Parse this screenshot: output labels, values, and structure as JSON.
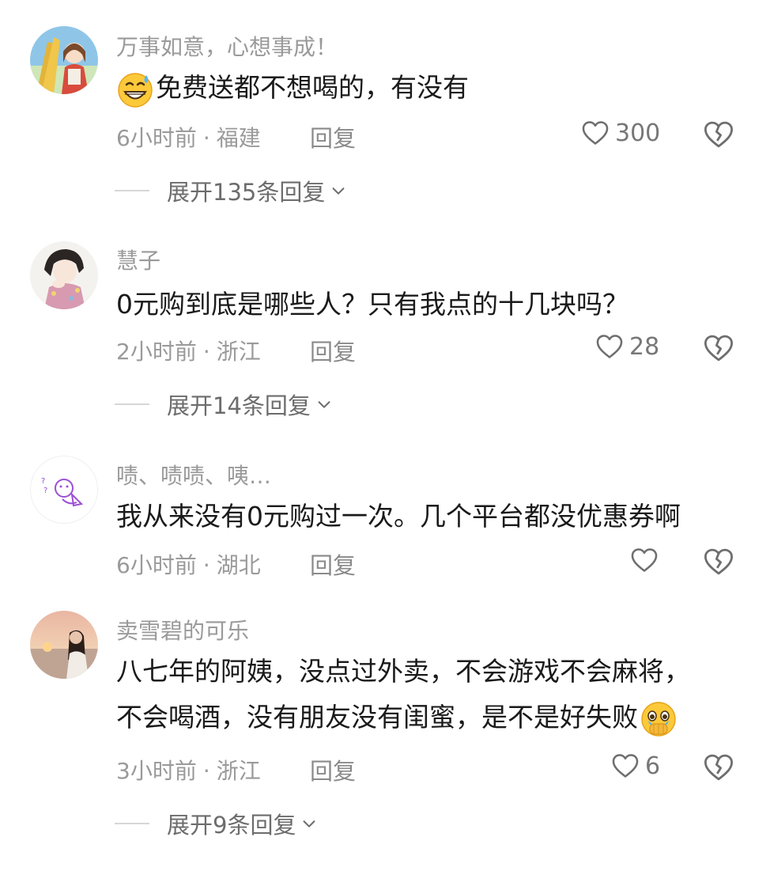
{
  "comments": [
    {
      "username": "万事如意，心想事成！",
      "text": "免费送都不想喝的，有没有",
      "text_emoji": "grinning-sweat-emoji",
      "time": "6小时前",
      "location": "福建",
      "reply_label": "回复",
      "likes": "300",
      "expand_label": "展开135条回复"
    },
    {
      "username": "慧子",
      "text": "0元购到底是哪些人？只有我点的十几块吗？",
      "time": "2小时前",
      "location": "浙江",
      "reply_label": "回复",
      "likes": "28",
      "expand_label": "展开14条回复"
    },
    {
      "username": "啧、啧啧、咦…",
      "text": "我从来没有0元购过一次。几个平台都没优惠券啊",
      "time": "6小时前",
      "location": "湖北",
      "reply_label": "回复",
      "likes": ""
    },
    {
      "username": "卖雪碧的可乐",
      "text_line1": "八七年的阿姨，没点过外卖，不会游戏不会麻将，",
      "text_line2": "不会喝酒，没有朋友没有闺蜜，是不是好失败",
      "text_emoji": "crying-holding-back-tears-emoji",
      "time": "3小时前",
      "location": "浙江",
      "reply_label": "回复",
      "likes": "6",
      "expand_label": "展开9条回复"
    }
  ],
  "meta_separator": "·",
  "icons": {
    "like": "heart-outline-icon",
    "dislike": "broken-heart-icon",
    "expand": "chevron-down-icon"
  },
  "colors": {
    "secondary_text": "#9a9a9a",
    "primary_text": "#1a1a1a",
    "icon": "#6e6e6e"
  }
}
